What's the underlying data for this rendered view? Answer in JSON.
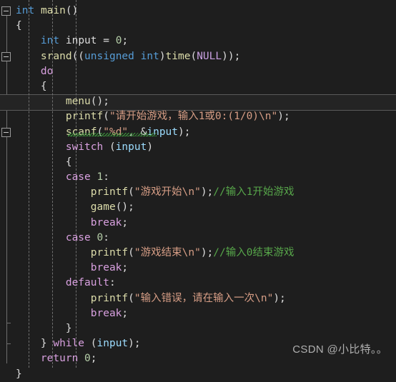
{
  "editor": {
    "theme": "visual-studio-dark",
    "background": "#1E1E1E",
    "foreground": "#DCDCDC",
    "current_line": 6,
    "colors": {
      "keyword_type": "#569CD6",
      "keyword_control": "#D8A0DF",
      "function": "#DCDCAA",
      "variable": "#9CDCFE",
      "number": "#B5CEA8",
      "string": "#D69D85",
      "comment": "#57A64A",
      "macro": "#C8A0E0",
      "squiggle_error": "#3E9E3E",
      "indent_guide": "#707070",
      "fold_marker": "#9A9A9A",
      "current_line_border": "#5A5A5A"
    }
  },
  "gutter": {
    "fold_markers": [
      {
        "name": "fold-main",
        "line": 1,
        "state": "expanded"
      },
      {
        "name": "fold-do",
        "line": 4,
        "state": "expanded"
      },
      {
        "name": "fold-switch",
        "line": 9,
        "state": "expanded"
      }
    ]
  },
  "code": {
    "lines": [
      {
        "n": 1,
        "tokens": [
          {
            "t": "int",
            "c": "kw"
          },
          {
            "t": " ",
            "c": "pl"
          },
          {
            "t": "main",
            "c": "fn"
          },
          {
            "t": "()",
            "c": "pl"
          }
        ]
      },
      {
        "n": 2,
        "tokens": [
          {
            "t": "{",
            "c": "br"
          }
        ]
      },
      {
        "n": 3,
        "tokens": [
          {
            "t": "    ",
            "c": "pl"
          },
          {
            "t": "int",
            "c": "kw"
          },
          {
            "t": " ",
            "c": "pl"
          },
          {
            "t": "input",
            "c": "pl"
          },
          {
            "t": " = ",
            "c": "pl"
          },
          {
            "t": "0",
            "c": "num"
          },
          {
            "t": ";",
            "c": "pl"
          }
        ]
      },
      {
        "n": 4,
        "tokens": [
          {
            "t": "    ",
            "c": "pl"
          },
          {
            "t": "srand",
            "c": "fn"
          },
          {
            "t": "((",
            "c": "pl"
          },
          {
            "t": "unsigned int",
            "c": "kw"
          },
          {
            "t": ")",
            "c": "pl"
          },
          {
            "t": "time",
            "c": "fn"
          },
          {
            "t": "(",
            "c": "pl"
          },
          {
            "t": "NULL",
            "c": "mac"
          },
          {
            "t": "));",
            "c": "pl"
          }
        ]
      },
      {
        "n": 5,
        "tokens": [
          {
            "t": "    ",
            "c": "pl"
          },
          {
            "t": "do",
            "c": "kw2"
          }
        ]
      },
      {
        "n": 6,
        "tokens": [
          {
            "t": "    ",
            "c": "pl"
          },
          {
            "t": "{",
            "c": "br"
          }
        ]
      },
      {
        "n": 7,
        "tokens": [
          {
            "t": "        ",
            "c": "pl"
          },
          {
            "t": "menu",
            "c": "fn"
          },
          {
            "t": "();",
            "c": "pl"
          }
        ]
      },
      {
        "n": 8,
        "tokens": [
          {
            "t": "        ",
            "c": "pl"
          },
          {
            "t": "printf",
            "c": "fn"
          },
          {
            "t": "(",
            "c": "pl"
          },
          {
            "t": "\"请开始游戏，输入1或0:(1/0)\\n\"",
            "c": "str"
          },
          {
            "t": ");",
            "c": "pl"
          }
        ]
      },
      {
        "n": 9,
        "tokens": [
          {
            "t": "        ",
            "c": "pl"
          },
          {
            "t": "scanf",
            "c": "fn"
          },
          {
            "t": "(",
            "c": "pl"
          },
          {
            "t": "\"%d\"",
            "c": "str"
          },
          {
            "t": ", &",
            "c": "pl"
          },
          {
            "t": "input",
            "c": "var"
          },
          {
            "t": ");",
            "c": "pl"
          }
        ]
      },
      {
        "n": 10,
        "tokens": [
          {
            "t": "        ",
            "c": "pl"
          },
          {
            "t": "switch",
            "c": "kw2"
          },
          {
            "t": " (",
            "c": "pl"
          },
          {
            "t": "input",
            "c": "var"
          },
          {
            "t": ")",
            "c": "pl"
          }
        ]
      },
      {
        "n": 11,
        "tokens": [
          {
            "t": "        ",
            "c": "pl"
          },
          {
            "t": "{",
            "c": "br"
          }
        ]
      },
      {
        "n": 12,
        "tokens": [
          {
            "t": "        ",
            "c": "pl"
          },
          {
            "t": "case",
            "c": "kw2"
          },
          {
            "t": " ",
            "c": "pl"
          },
          {
            "t": "1",
            "c": "num"
          },
          {
            "t": ":",
            "c": "pl"
          }
        ]
      },
      {
        "n": 13,
        "tokens": [
          {
            "t": "            ",
            "c": "pl"
          },
          {
            "t": "printf",
            "c": "fn"
          },
          {
            "t": "(",
            "c": "pl"
          },
          {
            "t": "\"游戏开始\\n\"",
            "c": "str"
          },
          {
            "t": ");",
            "c": "pl"
          },
          {
            "t": "//输入1开始游戏",
            "c": "cmt"
          }
        ]
      },
      {
        "n": 14,
        "tokens": [
          {
            "t": "            ",
            "c": "pl"
          },
          {
            "t": "game",
            "c": "fn"
          },
          {
            "t": "();",
            "c": "pl"
          }
        ]
      },
      {
        "n": 15,
        "tokens": [
          {
            "t": "            ",
            "c": "pl"
          },
          {
            "t": "break",
            "c": "kw2"
          },
          {
            "t": ";",
            "c": "pl"
          }
        ]
      },
      {
        "n": 16,
        "tokens": [
          {
            "t": "        ",
            "c": "pl"
          },
          {
            "t": "case",
            "c": "kw2"
          },
          {
            "t": " ",
            "c": "pl"
          },
          {
            "t": "0",
            "c": "num"
          },
          {
            "t": ":",
            "c": "pl"
          }
        ]
      },
      {
        "n": 17,
        "tokens": [
          {
            "t": "            ",
            "c": "pl"
          },
          {
            "t": "printf",
            "c": "fn"
          },
          {
            "t": "(",
            "c": "pl"
          },
          {
            "t": "\"游戏结束\\n\"",
            "c": "str"
          },
          {
            "t": ");",
            "c": "pl"
          },
          {
            "t": "//输入0结束游戏",
            "c": "cmt"
          }
        ]
      },
      {
        "n": 18,
        "tokens": [
          {
            "t": "            ",
            "c": "pl"
          },
          {
            "t": "break",
            "c": "kw2"
          },
          {
            "t": ";",
            "c": "pl"
          }
        ]
      },
      {
        "n": 19,
        "tokens": [
          {
            "t": "        ",
            "c": "pl"
          },
          {
            "t": "default",
            "c": "kw2"
          },
          {
            "t": ":",
            "c": "pl"
          }
        ]
      },
      {
        "n": 20,
        "tokens": [
          {
            "t": "            ",
            "c": "pl"
          },
          {
            "t": "printf",
            "c": "fn"
          },
          {
            "t": "(",
            "c": "pl"
          },
          {
            "t": "\"输入错误，请在输入一次\\n\"",
            "c": "str"
          },
          {
            "t": ");",
            "c": "pl"
          }
        ]
      },
      {
        "n": 21,
        "tokens": [
          {
            "t": "            ",
            "c": "pl"
          },
          {
            "t": "break",
            "c": "kw2"
          },
          {
            "t": ";",
            "c": "pl"
          }
        ]
      },
      {
        "n": 22,
        "tokens": [
          {
            "t": "        ",
            "c": "pl"
          },
          {
            "t": "}",
            "c": "br"
          }
        ]
      },
      {
        "n": 23,
        "tokens": [
          {
            "t": "    ",
            "c": "pl"
          },
          {
            "t": "}",
            "c": "br"
          },
          {
            "t": " ",
            "c": "pl"
          },
          {
            "t": "while",
            "c": "kw2"
          },
          {
            "t": " (",
            "c": "pl"
          },
          {
            "t": "input",
            "c": "var"
          },
          {
            "t": ");",
            "c": "pl"
          }
        ]
      },
      {
        "n": 24,
        "tokens": [
          {
            "t": "    ",
            "c": "pl"
          },
          {
            "t": "return",
            "c": "kw2"
          },
          {
            "t": " ",
            "c": "pl"
          },
          {
            "t": "0",
            "c": "num"
          },
          {
            "t": ";",
            "c": "pl"
          }
        ]
      },
      {
        "n": 25,
        "tokens": [
          {
            "t": "}",
            "c": "br"
          }
        ]
      }
    ]
  },
  "diagnostics": [
    {
      "name": "scanf-unsafe-squiggle",
      "line": 9,
      "kind": "warning",
      "underline": "green-wavy"
    }
  ],
  "watermark": {
    "text": "CSDN @小比特。。"
  }
}
